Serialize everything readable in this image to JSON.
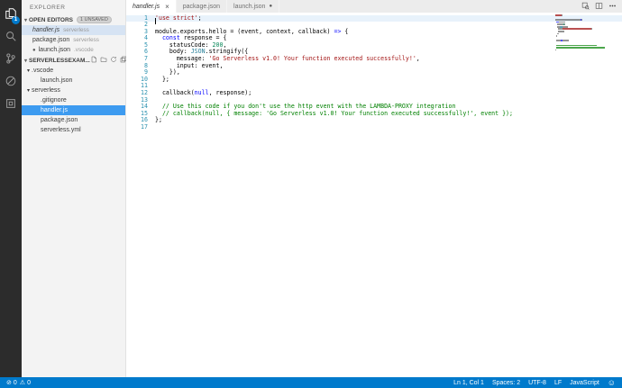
{
  "activity_bar": {
    "items": [
      {
        "name": "explorer",
        "active": true,
        "badge": "1"
      },
      {
        "name": "search",
        "active": false
      },
      {
        "name": "source-control",
        "active": false
      },
      {
        "name": "debug",
        "active": false
      },
      {
        "name": "extensions",
        "active": false
      }
    ]
  },
  "sidebar": {
    "title": "EXPLORER",
    "open_editors": {
      "header": "OPEN EDITORS",
      "badge": "1 UNSAVED",
      "items": [
        {
          "name": "handler.js",
          "detail": "serverless",
          "selected": true,
          "italic": true,
          "dirty": false
        },
        {
          "name": "package.json",
          "detail": "serverless",
          "selected": false,
          "italic": false,
          "dirty": false
        },
        {
          "name": "launch.json",
          "detail": ".vscode",
          "selected": false,
          "italic": false,
          "dirty": true
        }
      ]
    },
    "folder_section": {
      "header": "SERVERLESSEXAM...",
      "actions": [
        "new-file",
        "new-folder",
        "refresh",
        "collapse-all"
      ],
      "tree": [
        {
          "label": ".vscode",
          "type": "folder",
          "depth": 0,
          "expanded": true
        },
        {
          "label": "launch.json",
          "type": "file",
          "depth": 1
        },
        {
          "label": "serverless",
          "type": "folder",
          "depth": 0,
          "expanded": true
        },
        {
          "label": ".gitignore",
          "type": "file",
          "depth": 1
        },
        {
          "label": "handler.js",
          "type": "file",
          "depth": 1,
          "selected": true
        },
        {
          "label": "package.json",
          "type": "file",
          "depth": 1
        },
        {
          "label": "serverless.yml",
          "type": "file",
          "depth": 1
        }
      ]
    }
  },
  "tabs": [
    {
      "label": "handler.js",
      "active": true,
      "italic": true,
      "close": true,
      "dirty": false
    },
    {
      "label": "package.json",
      "active": false,
      "italic": false,
      "close": false,
      "dirty": false
    },
    {
      "label": "launch.json",
      "active": false,
      "italic": false,
      "close": false,
      "dirty": true
    }
  ],
  "editor_actions": [
    "open-preview",
    "split-editor",
    "more-actions"
  ],
  "editor": {
    "current_line": 1,
    "cursor": {
      "line": 1,
      "col": 1
    },
    "lines": [
      {
        "n": 1,
        "tokens": [
          [
            "str",
            "'use strict'"
          ],
          [
            "def",
            ";"
          ]
        ]
      },
      {
        "n": 2,
        "tokens": []
      },
      {
        "n": 3,
        "tokens": [
          [
            "def",
            "module.exports.hello = (event, context, callback) "
          ],
          [
            "kw",
            "=>"
          ],
          [
            "def",
            " {"
          ]
        ]
      },
      {
        "n": 4,
        "tokens": [
          [
            "def",
            "  "
          ],
          [
            "kw",
            "const"
          ],
          [
            "def",
            " response = {"
          ]
        ]
      },
      {
        "n": 5,
        "tokens": [
          [
            "def",
            "    statusCode: "
          ],
          [
            "num",
            "200"
          ],
          [
            "def",
            ","
          ]
        ]
      },
      {
        "n": 6,
        "tokens": [
          [
            "def",
            "    body: "
          ],
          [
            "sup",
            "JSON"
          ],
          [
            "def",
            ".stringify({"
          ]
        ]
      },
      {
        "n": 7,
        "tokens": [
          [
            "def",
            "      message: "
          ],
          [
            "str",
            "'Go Serverless v1.0! Your function executed successfully!'"
          ],
          [
            "def",
            ","
          ]
        ]
      },
      {
        "n": 8,
        "tokens": [
          [
            "def",
            "      input: event,"
          ]
        ]
      },
      {
        "n": 9,
        "tokens": [
          [
            "def",
            "    }),"
          ]
        ]
      },
      {
        "n": 10,
        "tokens": [
          [
            "def",
            "  };"
          ]
        ]
      },
      {
        "n": 11,
        "tokens": []
      },
      {
        "n": 12,
        "tokens": [
          [
            "def",
            "  callback("
          ],
          [
            "kw",
            "null"
          ],
          [
            "def",
            ", response);"
          ]
        ]
      },
      {
        "n": 13,
        "tokens": []
      },
      {
        "n": 14,
        "tokens": [
          [
            "com",
            "  // Use this code if you don't use the http event with the LAMBDA-PROXY integration"
          ]
        ]
      },
      {
        "n": 15,
        "tokens": [
          [
            "com",
            "  // callback(null, { message: 'Go Serverless v1.0! Your function executed successfully!', event });"
          ]
        ]
      },
      {
        "n": 16,
        "tokens": [
          [
            "def",
            "};"
          ]
        ]
      },
      {
        "n": 17,
        "tokens": []
      }
    ]
  },
  "status_bar": {
    "left": [
      {
        "icon": "error-circle",
        "text": "0"
      },
      {
        "icon": "warning-triangle",
        "text": "0"
      }
    ],
    "right": [
      "Ln 1, Col 1",
      "Spaces: 2",
      "UTF-8",
      "LF",
      "JavaScript"
    ],
    "feedback_icon": "smiley"
  },
  "colors": {
    "status_bar": "#007acc",
    "activity_bar": "#2c2c2c",
    "sidebar": "#f3f3f3",
    "selection_active": "#3d9bf0",
    "selection_inactive": "#d6e3f3",
    "token_string": "#a31515",
    "token_keyword": "#0000ff",
    "token_number": "#09885a",
    "token_comment": "#008000",
    "token_support": "#267f99",
    "line_number": "#2b91af"
  }
}
